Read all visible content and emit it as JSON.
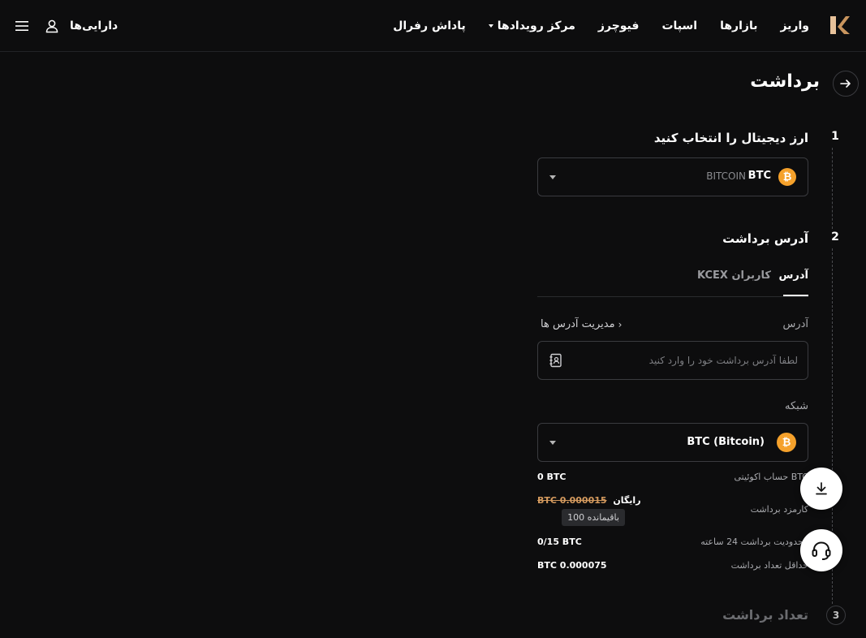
{
  "header": {
    "nav": [
      "واریز",
      "بازارها",
      "اسپات",
      "فیوچرز",
      "مرکز رویدادها",
      "پاداش رفرال"
    ],
    "assets_label": "دارایی‌ها",
    "logo_color": "#e8c29a"
  },
  "page": {
    "title": "برداشت"
  },
  "step1": {
    "number": "1",
    "title": "ارز دیجیتال را انتخاب کنید",
    "selected_symbol": "BTC",
    "selected_name": "BITCOIN",
    "coin_glyph": "₿"
  },
  "step2": {
    "number": "2",
    "title": "آدرس برداشت",
    "tabs": [
      "آدرس",
      "کاربران KCEX"
    ],
    "address_label": "آدرس",
    "manage_link": "مدیریت آدرس ها",
    "address_placeholder": "لطفا آدرس برداشت خود را وارد کنید",
    "network_label": "شبکه",
    "network_value": "BTC (Bitcoin)"
  },
  "info": {
    "equity_label": "BTC حساب اکوئیتی",
    "equity_value": "0 BTC",
    "fee_label": "کارمزد برداشت",
    "fee_strike": "BTC 0.000015",
    "fee_free": "رایگان",
    "remaining": "باقیمانده 100",
    "limit_label": "محدودیت برداشت 24 ساعته",
    "limit_value": "0/15 BTC",
    "min_label": "حداقل تعداد برداشت",
    "min_value": "BTC 0.000075"
  },
  "step3": {
    "number": "3",
    "title": "تعداد برداشت"
  },
  "colors": {
    "accent_btc": "#f5a12b",
    "background": "#0d0d0e"
  }
}
